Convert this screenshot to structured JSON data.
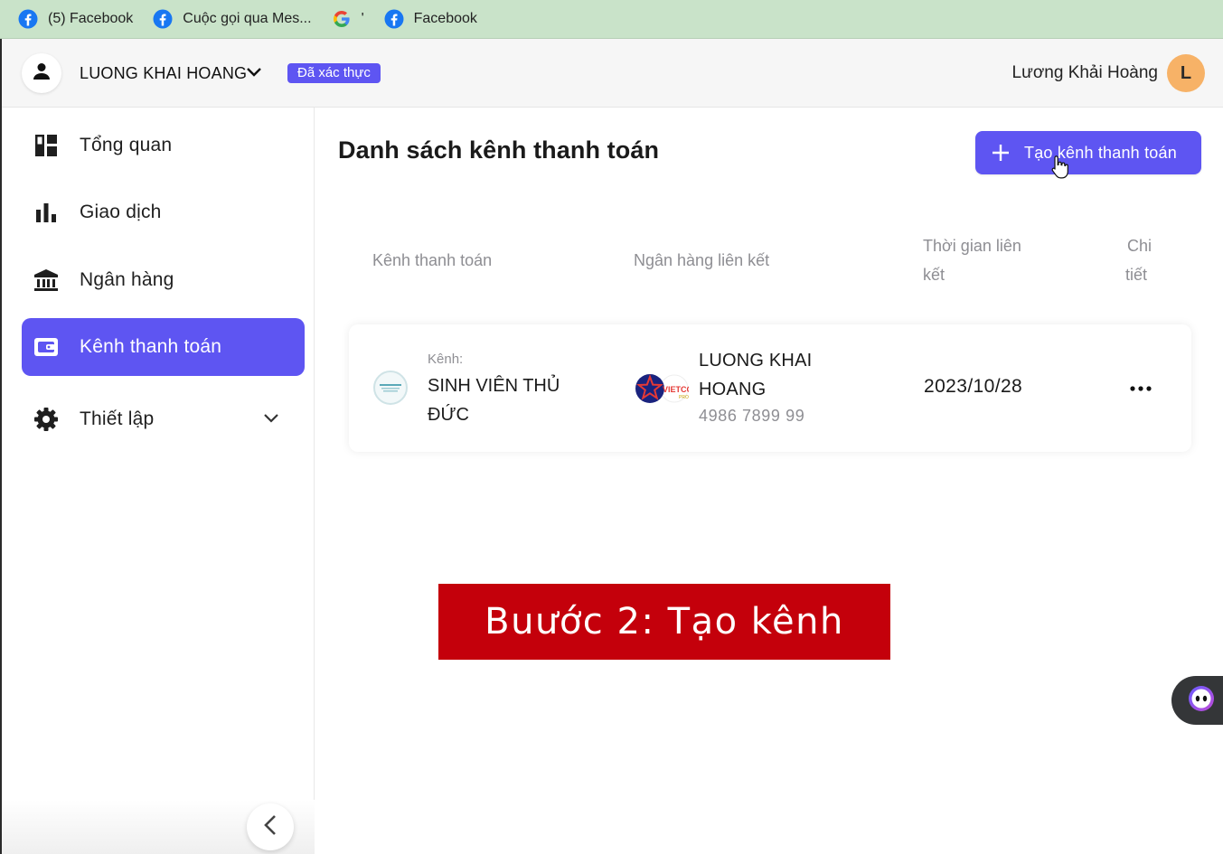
{
  "bookmarks": [
    {
      "label": "(5) Facebook",
      "icon": "facebook-icon"
    },
    {
      "label": "Cuộc gọi qua Mes...",
      "icon": "facebook-icon"
    },
    {
      "label": "'",
      "icon": "google-icon"
    },
    {
      "label": "Facebook",
      "icon": "facebook-icon"
    }
  ],
  "header": {
    "account_name": "LUONG KHAI HOANG",
    "verified_badge": "Đã xác thực",
    "user_name": "Lương Khải Hoàng",
    "user_initial": "L"
  },
  "sidebar": {
    "items": [
      {
        "label": "Tổng quan",
        "icon": "dashboard-icon"
      },
      {
        "label": "Giao dịch",
        "icon": "bar-chart-icon"
      },
      {
        "label": "Ngân hàng",
        "icon": "bank-icon"
      },
      {
        "label": "Kênh thanh toán",
        "icon": "wallet-icon",
        "active": true
      },
      {
        "label": "Thiết lập",
        "icon": "gear-icon"
      }
    ]
  },
  "main": {
    "title": "Danh sách kênh thanh toán",
    "create_button": "Tạo kênh thanh toán",
    "columns": {
      "channel": "Kênh thanh toán",
      "bank": "Ngân hàng liên kết",
      "time_line1": "Thời gian liên",
      "time_line2": "kết",
      "detail_line1": "Chi",
      "detail_line2": "tiết"
    },
    "rows": [
      {
        "channel_caption": "Kênh:",
        "channel_name": "SINH VIÊN THỦ ĐỨC",
        "bank_owner": "LUONG KHAI HOANG",
        "bank_account": "4986 7899 99",
        "bank_logo_text": "VIETCOR",
        "linked_date": "2023/10/28"
      }
    ],
    "banner": "Buước 2: Tạo kênh"
  },
  "colors": {
    "accent": "#5e55f2",
    "banner": "#c4000b",
    "bookmark_bar": "#c9e3c9"
  }
}
